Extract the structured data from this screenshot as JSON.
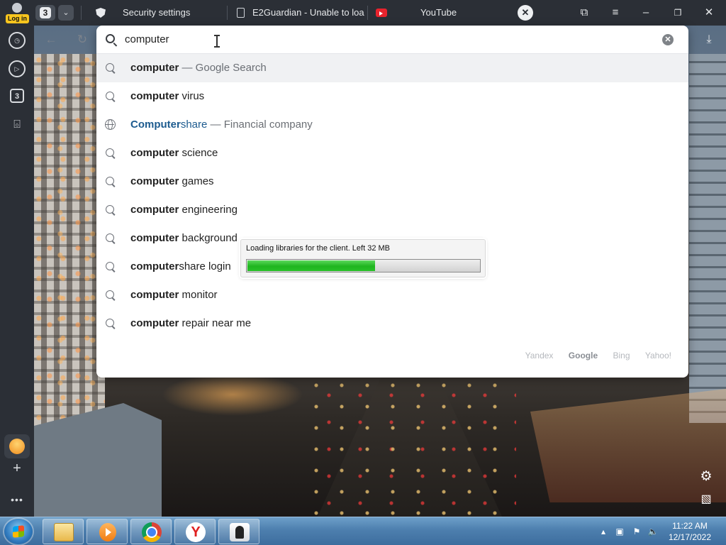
{
  "colors": {
    "browser_chrome": "#2b2f36",
    "accent_login": "#f7c51e",
    "progress_green": "#1fb51f",
    "suggestion_highlight": "#f0f1f3",
    "company_blue": "#1d5b8f"
  },
  "profile": {
    "login_label": "Log in",
    "icon": "user-icon"
  },
  "tabbar": {
    "tab_count": "3",
    "tabs": [
      {
        "label": "Security settings",
        "icon": "shield-icon"
      },
      {
        "label": "E2Guardian - Unable to loa",
        "icon": "document-icon"
      },
      {
        "label": "YouTube",
        "icon": "youtube-icon"
      }
    ]
  },
  "sidebar": {
    "tab_group_count": "3"
  },
  "omnibox": {
    "query": "computer",
    "suggestions": [
      {
        "bold": "computer",
        "rest": " — Google Search",
        "type": "search"
      },
      {
        "bold": "computer",
        "rest": " virus",
        "type": "search"
      },
      {
        "bold": "Computer",
        "rest": "share",
        "extra": " — Financial company",
        "type": "site"
      },
      {
        "bold": "computer",
        "rest": " science",
        "type": "search"
      },
      {
        "bold": "computer",
        "rest": " games",
        "type": "search"
      },
      {
        "bold": "computer",
        "rest": " engineering",
        "type": "search"
      },
      {
        "bold": "computer",
        "rest": " background",
        "type": "search"
      },
      {
        "bold": "computer",
        "rest": "share login",
        "type": "search"
      },
      {
        "bold": "computer",
        "rest": " monitor",
        "type": "search"
      },
      {
        "bold": "computer",
        "rest": " repair near me",
        "type": "search"
      }
    ],
    "engines": [
      "Yandex",
      "Google",
      "Bing",
      "Yahoo!"
    ],
    "selected_engine": "Google"
  },
  "loader": {
    "message": "Loading libraries for the client. Left 32 MB",
    "progress_fraction": 0.55
  },
  "taskbar": {
    "clock_time": "11:22 AM",
    "clock_date": "12/17/2022"
  }
}
